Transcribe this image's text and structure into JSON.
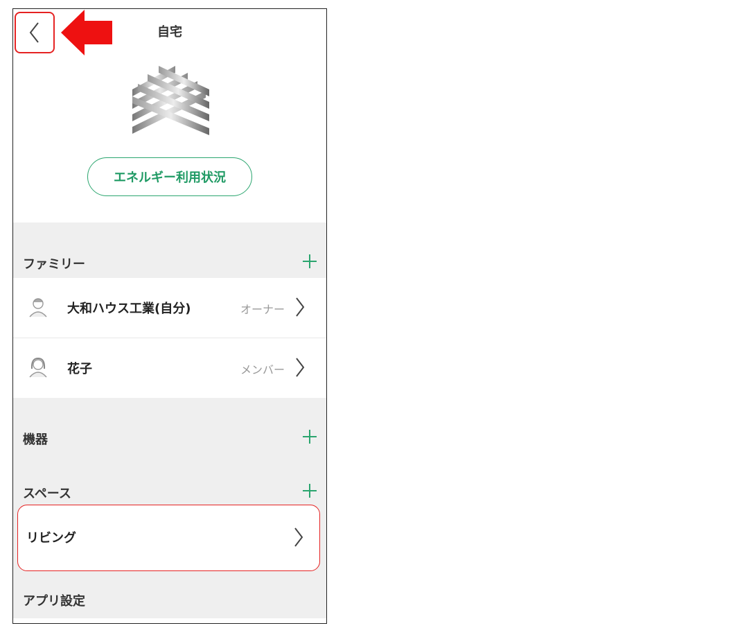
{
  "header": {
    "title": "自宅"
  },
  "energy_button": {
    "label": "エネルギー利用状況"
  },
  "family": {
    "label": "ファミリー",
    "members": [
      {
        "name": "大和ハウス工業(自分)",
        "role": "オーナー"
      },
      {
        "name": "花子",
        "role": "メンバー"
      }
    ]
  },
  "devices": {
    "label": "機器"
  },
  "spaces": {
    "label": "スペース",
    "items": [
      {
        "name": "リビング"
      }
    ]
  },
  "app_settings": {
    "label": "アプリ設定"
  },
  "colors": {
    "accent": "#2aa56e",
    "highlight": "#e52222",
    "section_bg": "#efefef"
  },
  "icons": {
    "back": "chevron-left-icon",
    "add": "plus-icon",
    "next": "chevron-right-icon",
    "avatar": "user-avatar-icon",
    "logo": "woven-house-logo"
  }
}
